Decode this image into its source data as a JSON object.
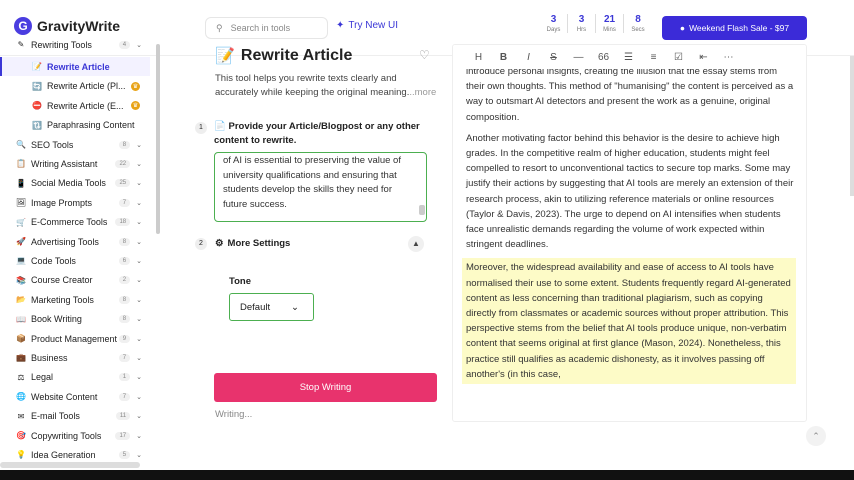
{
  "header": {
    "logo_text": "GravityWrite",
    "search_placeholder": "Search in tools",
    "try_new": "Try New UI",
    "timer": [
      {
        "num": "3",
        "label": "Days"
      },
      {
        "num": "3",
        "label": "Hrs"
      },
      {
        "num": "21",
        "label": "Mins"
      },
      {
        "num": "8",
        "label": "Secs"
      }
    ],
    "flash_sale": "Weekend Flash Sale - $97"
  },
  "sidebar": {
    "items": [
      {
        "label": "Rewriting Tools",
        "icon": "✎",
        "badge": "4",
        "top": 0
      },
      {
        "label": "Rewrite Article",
        "icon": "📝",
        "active": true
      },
      {
        "label": "Rewrite Article (Pl...",
        "icon": "🔄",
        "pro": true
      },
      {
        "label": "Rewrite Article (E...",
        "icon": "⛔",
        "pro": true
      },
      {
        "label": "Paraphrasing Content",
        "icon": "🔃"
      },
      {
        "label": "SEO Tools",
        "icon": "🔍",
        "badge": "8"
      },
      {
        "label": "Writing Assistant",
        "icon": "📋",
        "badge": "22"
      },
      {
        "label": "Social Media Tools",
        "icon": "📱",
        "badge": "25"
      },
      {
        "label": "Image Prompts",
        "icon": "🖼",
        "badge": "7"
      },
      {
        "label": "E-Commerce Tools",
        "icon": "🛒",
        "badge": "18"
      },
      {
        "label": "Advertising Tools",
        "icon": "🚀",
        "badge": "8"
      },
      {
        "label": "Code Tools",
        "icon": "💻",
        "badge": "6"
      },
      {
        "label": "Course Creator",
        "icon": "📚",
        "badge": "2"
      },
      {
        "label": "Marketing Tools",
        "icon": "📂",
        "badge": "8"
      },
      {
        "label": "Book Writing",
        "icon": "📖",
        "badge": "8"
      },
      {
        "label": "Product Management",
        "icon": "📦",
        "badge": "9"
      },
      {
        "label": "Business",
        "icon": "💼",
        "badge": "7"
      },
      {
        "label": "Legal",
        "icon": "⚖",
        "badge": "1"
      },
      {
        "label": "Website Content",
        "icon": "🌐",
        "badge": "7"
      },
      {
        "label": "E-mail Tools",
        "icon": "✉",
        "badge": "11"
      },
      {
        "label": "Copywriting Tools",
        "icon": "🎯",
        "badge": "17"
      },
      {
        "label": "Idea Generation",
        "icon": "💡",
        "badge": "5"
      }
    ]
  },
  "main": {
    "title": "Rewrite Article",
    "title_icon": "📝",
    "description": "This tool helps you rewrite texts clearly and accurately while keeping the original meaning.",
    "more": "..more",
    "step1_num": "1",
    "step1_label": "Provide your Article/Blogpost or any other content to rewrite.",
    "step1_icon": "📄",
    "textarea_text": "of AI is essential to preserving the value of university qualifications and ensuring that students develop the skills they need for future success.",
    "step2_num": "2",
    "step2_icon": "⚙",
    "step2_label": "More Settings",
    "tone_label": "Tone",
    "tone_value": "Default",
    "stop_button": "Stop Writing",
    "status": "Writing..."
  },
  "editor": {
    "toolbar": [
      "H",
      "B",
      "I",
      "S",
      "—",
      "66",
      "☰",
      "≡",
      "☑",
      "⇤",
      "⋯"
    ],
    "paragraphs": [
      {
        "text": "introduce personal insights, creating the illusion that the essay stems from their own thoughts. This method of \"humanising\" the content is perceived as a way to outsmart AI detectors and present the work as a genuine, original composition.",
        "highlight": false
      },
      {
        "text": "Another motivating factor behind this behavior is the desire to achieve high grades. In the competitive realm of higher education, students might feel compelled to resort to unconventional tactics to secure top marks. Some may justify their actions by suggesting that AI tools are merely an extension of their research process, akin to utilizing reference materials or online resources (Taylor & Davis, 2023). The urge to depend on AI intensifies when students face unrealistic demands regarding the volume of work expected within stringent deadlines.",
        "highlight": false
      },
      {
        "text": "Moreover, the widespread availability and ease of access to AI tools have normalised their use to some extent. Students frequently regard AI-generated content as less concerning than traditional plagiarism, such as copying directly from classmates or academic sources without proper attribution. This perspective stems from the belief that AI tools produce unique, non-verbatim content that seems original at first glance (Mason, 2024). Nonetheless, this practice still qualifies as academic dishonesty, as it involves passing off another's (in this case,",
        "highlight": true
      }
    ]
  }
}
